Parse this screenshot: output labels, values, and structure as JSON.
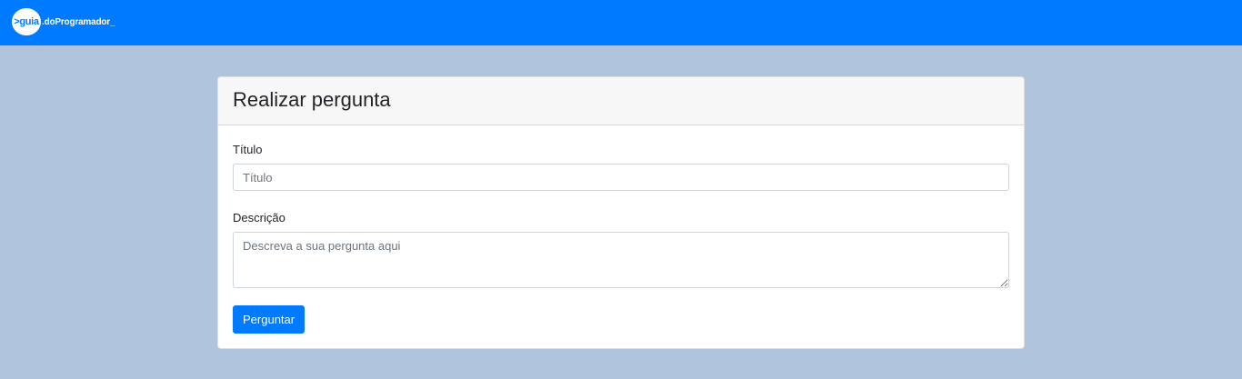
{
  "navbar": {
    "logo_badge": ">guia",
    "logo_text": ".doProgramador_",
    "color": "#007bff"
  },
  "page": {
    "background": "#b0c4de"
  },
  "form": {
    "title": "Realizar pergunta",
    "titulo_label": "Título",
    "titulo_placeholder": "Título",
    "titulo_value": "",
    "descricao_label": "Descrição",
    "descricao_placeholder": "Descreva a sua pergunta aqui",
    "descricao_value": "",
    "submit_label": "Perguntar"
  }
}
